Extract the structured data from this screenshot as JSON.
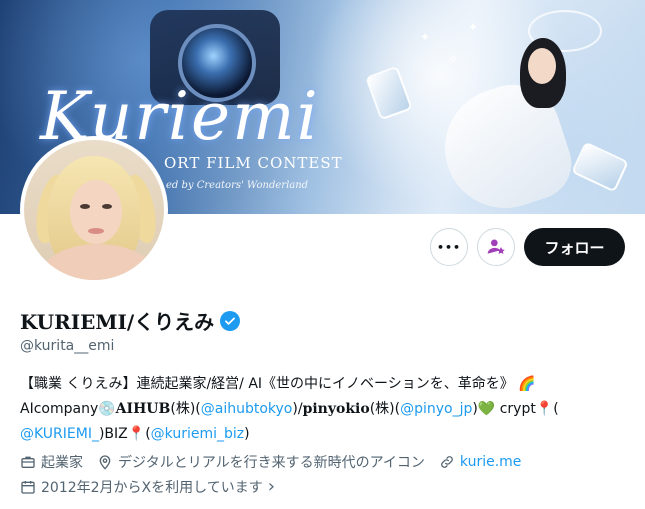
{
  "banner": {
    "title": "Kuriemi",
    "subtitle": "ORT FILM CONTEST",
    "byline": "ed by Creators' Wonderland"
  },
  "actions": {
    "more_label": "•••",
    "follow_label": "フォロー"
  },
  "profile": {
    "name": "KURIEMI/くりえみ",
    "handle": "@kurita__emi",
    "verified": true
  },
  "bio": {
    "line1": "【職業 くりえみ】連続起業家/経営/ AI《世の中にイノベーションを、革命を》",
    "line1_emoji": "🌈",
    "line2_prefix": "AIcompany",
    "line2_disc": "💿",
    "line2_aihub": "AIHUB",
    "line2_kabu1": "(株)(",
    "line2_link1": "@aihubtokyo",
    "line2_close1": ")/",
    "line2_pinyokio": "pinyokio",
    "line2_kabu2": "(株)(",
    "line2_link2": "@pinyo_jp",
    "line2_close2": ")",
    "line2_heart": "💚",
    "line2_crypt": " crypt",
    "line2_pin": "📍",
    "line2_paren": "(",
    "line3_link1": "@KURIEMI_",
    "line3_biz": ")BIZ",
    "line3_pin": "📍",
    "line3_paren": "(",
    "line3_link2": "@kuriemi_biz",
    "line3_close": ")"
  },
  "meta": {
    "job": "起業家",
    "location": "デジタルとリアルを行き来する新時代のアイコン",
    "website": "kurie.me",
    "joined": "2012年2月からXを利用しています",
    "joined_chevron": "›"
  },
  "colors": {
    "accent": "#1d9bf0",
    "follow_bg": "#0f1419",
    "secondary_text": "#536471"
  }
}
